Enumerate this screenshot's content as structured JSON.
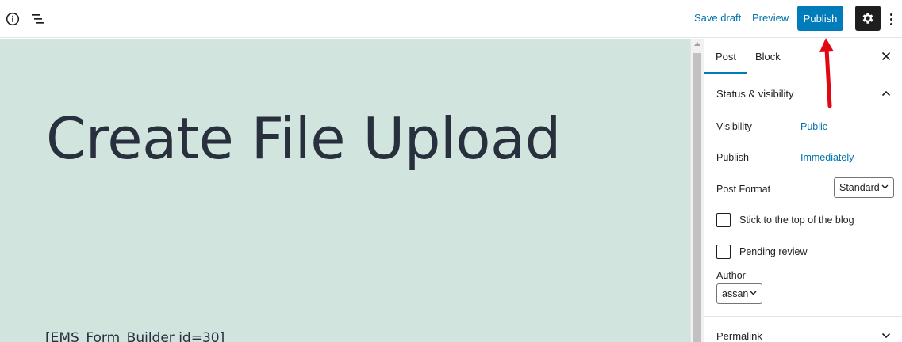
{
  "toolbar": {
    "save_draft": "Save draft",
    "preview": "Preview",
    "publish": "Publish"
  },
  "editor": {
    "title": "Create File Upload",
    "shortcode_prefix": "[",
    "shortcode_spell": "EMS_Form_Builder",
    "shortcode_suffix": " id=30]"
  },
  "sidebar": {
    "tabs": [
      "Post",
      "Block"
    ],
    "status_panel": {
      "title": "Status & visibility",
      "visibility_label": "Visibility",
      "visibility_value": "Public",
      "publish_label": "Publish",
      "publish_value": "Immediately",
      "post_format_label": "Post Format",
      "post_format_value": "Standard",
      "sticky_label": "Stick to the top of the blog",
      "pending_label": "Pending review",
      "author_label": "Author",
      "author_value": "assan"
    },
    "permalink_panel": {
      "title": "Permalink"
    }
  },
  "colors": {
    "accent": "#007cba",
    "link": "#0073aa",
    "canvas_bg": "#d1e4dd",
    "annotation": "#e30613"
  },
  "icons": [
    "info-icon",
    "list-view-icon",
    "gear-icon",
    "more-vertical-icon",
    "close-icon",
    "chevron-up-icon",
    "chevron-down-icon"
  ]
}
